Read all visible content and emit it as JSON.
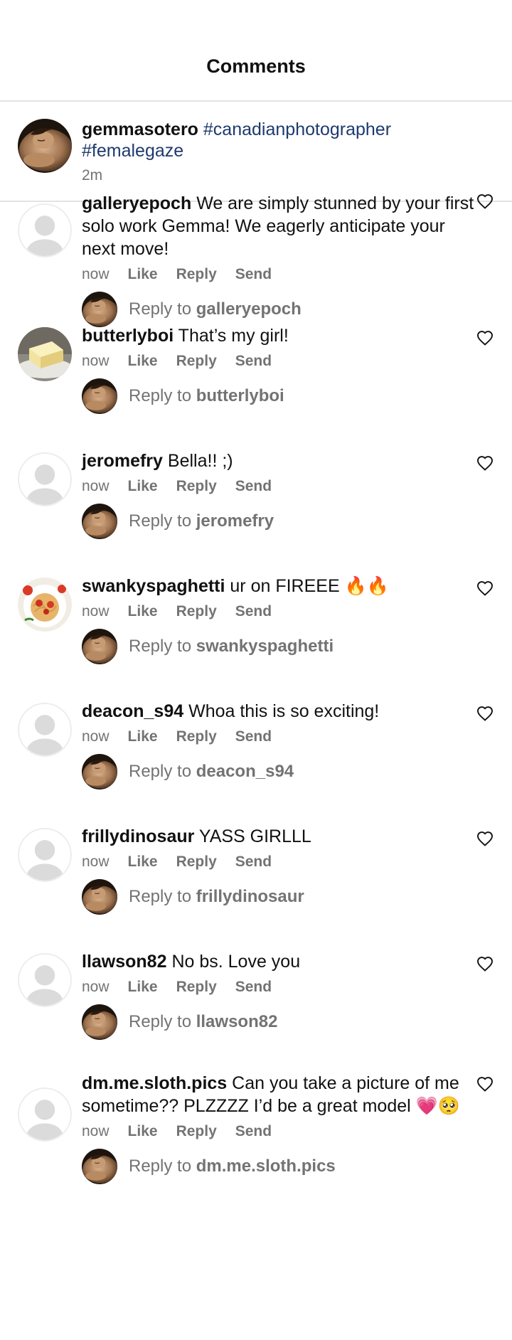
{
  "header": {
    "title": "Comments"
  },
  "caption": {
    "username": "gemmasotero",
    "hashtags": "#canadianphotographer #femalegaze",
    "time": "2m"
  },
  "comments": [
    {
      "username": "galleryepoch",
      "text": "We are simply stunned by your first solo work Gemma! We eagerly anticipate your next move!",
      "time": "now",
      "like": "Like",
      "reply": "Reply",
      "send": "Send",
      "reply_prefix": "Reply to",
      "reply_target": "galleryepoch",
      "avatar": "default-avatar-icon"
    },
    {
      "username": "butterlyboi",
      "text": "That’s my girl!",
      "time": "now",
      "like": "Like",
      "reply": "Reply",
      "send": "Send",
      "reply_prefix": "Reply to",
      "reply_target": "butterlyboi",
      "avatar": "butter-photo"
    },
    {
      "username": "jeromefry",
      "text": "Bella!! ;)",
      "time": "now",
      "like": "Like",
      "reply": "Reply",
      "send": "Send",
      "reply_prefix": "Reply to",
      "reply_target": "jeromefry",
      "avatar": "default-avatar-icon"
    },
    {
      "username": "swankyspaghetti",
      "text": "ur on FIREEE 🔥🔥",
      "time": "now",
      "like": "Like",
      "reply": "Reply",
      "send": "Send",
      "reply_prefix": "Reply to",
      "reply_target": "swankyspaghetti",
      "avatar": "spaghetti-photo"
    },
    {
      "username": "deacon_s94",
      "text": "Whoa this is so exciting!",
      "time": "now",
      "like": "Like",
      "reply": "Reply",
      "send": "Send",
      "reply_prefix": "Reply to",
      "reply_target": "deacon_s94",
      "avatar": "default-avatar-icon"
    },
    {
      "username": "frillydinosaur",
      "text": "YASS GIRLLL",
      "time": "now",
      "like": "Like",
      "reply": "Reply",
      "send": "Send",
      "reply_prefix": "Reply to",
      "reply_target": "frillydinosaur",
      "avatar": "default-avatar-icon"
    },
    {
      "username": "llawson82",
      "text": "No bs. Love you",
      "time": "now",
      "like": "Like",
      "reply": "Reply",
      "send": "Send",
      "reply_prefix": "Reply to",
      "reply_target": "llawson82",
      "avatar": "default-avatar-icon"
    },
    {
      "username": "dm.me.sloth.pics",
      "text": "Can you take a picture of me sometime?? PLZZZZ I’d be a great model 💗🥺",
      "time": "now",
      "like": "Like",
      "reply": "Reply",
      "send": "Send",
      "reply_prefix": "Reply to",
      "reply_target": "dm.me.sloth.pics",
      "avatar": "default-avatar-icon"
    }
  ]
}
